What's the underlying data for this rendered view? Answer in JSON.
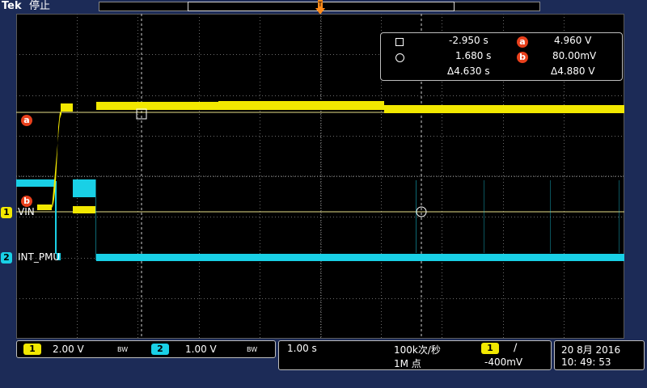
{
  "header": {
    "brand": "Tek",
    "status": "停止"
  },
  "cursor_readout": {
    "cursor1_time": "-2.950 s",
    "cursor2_time": "1.680 s",
    "delta_time": "Δ4.630 s",
    "cursor_a_badge": "a",
    "cursor_b_badge": "b",
    "cursor_a_value": "4.960 V",
    "cursor_b_value": "80.00mV",
    "delta_value": "Δ4.880 V"
  },
  "channels": {
    "ch1": {
      "number": "1",
      "label": "VIN",
      "scale": "2.00 V",
      "bw": "BW",
      "color": "#f2e800"
    },
    "ch2": {
      "number": "2",
      "label": "INT_PMU",
      "scale": "1.00 V",
      "bw": "BW",
      "color": "#19d0e6"
    }
  },
  "ref_markers": {
    "a": "a",
    "b": "b",
    "color": "#e8401c"
  },
  "timebase": {
    "scale": "1.00 s",
    "sample_rate": "100k次/秒",
    "record_length": "1M 点"
  },
  "trigger": {
    "source": "1",
    "slope": "∕",
    "level": "-400mV",
    "marker_color": "#ff8a1a"
  },
  "datetime": {
    "date": "20 8月   2016",
    "time": "10: 49: 53"
  }
}
